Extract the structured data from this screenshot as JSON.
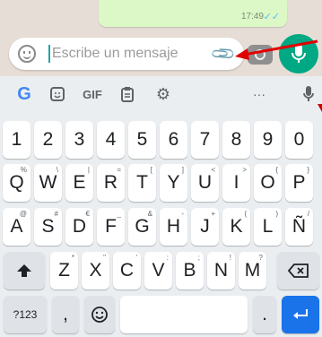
{
  "chat": {
    "time": "17:49",
    "ticks": "✓✓"
  },
  "input": {
    "placeholder": "Escribe un mensaje"
  },
  "toolbar": {
    "google": "G",
    "gif": "GIF",
    "more": "···"
  },
  "keyboard": {
    "row_numbers": [
      "1",
      "2",
      "3",
      "4",
      "5",
      "6",
      "7",
      "8",
      "9",
      "0"
    ],
    "row1": [
      {
        "label": "Q",
        "hint": "%"
      },
      {
        "label": "W",
        "hint": "\\"
      },
      {
        "label": "E",
        "hint": "|"
      },
      {
        "label": "R",
        "hint": "="
      },
      {
        "label": "T",
        "hint": "["
      },
      {
        "label": "Y",
        "hint": "]"
      },
      {
        "label": "U",
        "hint": "<"
      },
      {
        "label": "I",
        "hint": ">"
      },
      {
        "label": "O",
        "hint": "{"
      },
      {
        "label": "P",
        "hint": "}"
      }
    ],
    "row2": [
      {
        "label": "A",
        "hint": "@"
      },
      {
        "label": "S",
        "hint": "#"
      },
      {
        "label": "D",
        "hint": "€"
      },
      {
        "label": "F",
        "hint": "_"
      },
      {
        "label": "G",
        "hint": "&"
      },
      {
        "label": "H",
        "hint": "-"
      },
      {
        "label": "J",
        "hint": "+"
      },
      {
        "label": "K",
        "hint": "("
      },
      {
        "label": "L",
        "hint": ")"
      },
      {
        "label": "Ñ",
        "hint": "/"
      }
    ],
    "row3": [
      {
        "label": "Z",
        "hint": "*"
      },
      {
        "label": "X",
        "hint": "\""
      },
      {
        "label": "C",
        "hint": "'"
      },
      {
        "label": "V",
        "hint": ":"
      },
      {
        "label": "B",
        "hint": ";"
      },
      {
        "label": "N",
        "hint": "!"
      },
      {
        "label": "M",
        "hint": "?"
      }
    ],
    "symbols_label": "?123",
    "comma": ",",
    "period": "."
  },
  "colors": {
    "accent": "#00a884",
    "enter": "#1a73e8",
    "arrow": "#e00000"
  }
}
